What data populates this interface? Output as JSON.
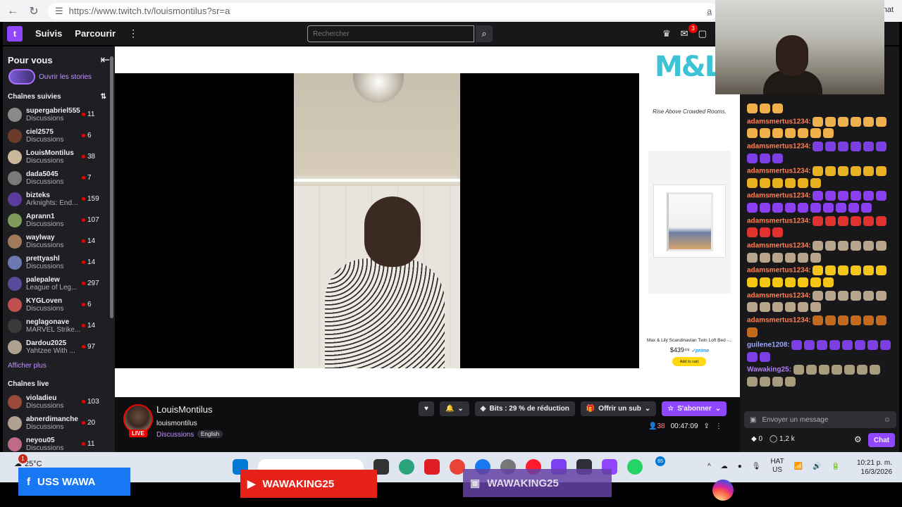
{
  "browser": {
    "url": "https://www.twitch.tv/louismontilus?sr=a",
    "right_text": "hat"
  },
  "topnav": {
    "following": "Suivis",
    "browse": "Parcourir",
    "search_placeholder": "Rechercher",
    "notifications_count": "3"
  },
  "sidebar": {
    "for_you": "Pour vous",
    "stories": "Ouvrir les stories",
    "followed_title": "Chaînes suivies",
    "followed": [
      {
        "name": "supergabriel555",
        "category": "Discussions",
        "viewers": "11"
      },
      {
        "name": "ciel2575",
        "category": "Discussions",
        "viewers": "6"
      },
      {
        "name": "LouisMontilus",
        "category": "Discussions",
        "viewers": "38"
      },
      {
        "name": "dada5045",
        "category": "Discussions",
        "viewers": "7"
      },
      {
        "name": "bizteks",
        "category": "Arknights: End...",
        "viewers": "159"
      },
      {
        "name": "Aprann1",
        "category": "Discussions",
        "viewers": "107"
      },
      {
        "name": "waylway",
        "category": "Discussions",
        "viewers": "14"
      },
      {
        "name": "prettyashl",
        "category": "Discussions",
        "viewers": "14"
      },
      {
        "name": "palepalew",
        "category": "League of Leg...",
        "viewers": "297"
      },
      {
        "name": "KYGLoven",
        "category": "Discussions",
        "viewers": "6"
      },
      {
        "name": "neglagonave",
        "category": "MARVEL Strike...",
        "viewers": "14"
      },
      {
        "name": "Dardou2025",
        "category": "Yahtzee With ...",
        "viewers": "97"
      }
    ],
    "show_more": "Afficher plus",
    "live_title": "Chaînes live",
    "live": [
      {
        "name": "violadieu",
        "category": "Discussions",
        "viewers": "103"
      },
      {
        "name": "abnerdimanche",
        "category": "Discussions",
        "viewers": "20"
      },
      {
        "name": "neyou05",
        "category": "Discussions",
        "viewers": "11"
      }
    ]
  },
  "ad": {
    "logo": "M&L",
    "tagline": "Rise Above Crowded Rooms.",
    "product": "Max & Lily Scandinavian Twin Loft Bed -...",
    "price": "$439⁴⁹",
    "prime": "✓prime",
    "cart": "Add to cart"
  },
  "stream": {
    "name": "LouisMontilus",
    "handle": "louismontilus",
    "category": "Discussions",
    "language": "English",
    "live": "LIVE",
    "bits": "Bits : 29 % de réduction",
    "gift": "Offrir un sub",
    "subscribe": "S'abonner",
    "viewers": "38",
    "uptime": "00:47:09"
  },
  "chat": {
    "messages": [
      {
        "user": "",
        "color": "#ff7f50",
        "emotes": 3,
        "emote_color": "#f0b04c"
      },
      {
        "user": "adamsmertus1234:",
        "color": "#ff7f50",
        "emotes": 13,
        "emote_color": "#f0b04c"
      },
      {
        "user": "adamsmertus1234:",
        "color": "#ff7f50",
        "emotes": 9,
        "emote_color": "#7b3fe4"
      },
      {
        "user": "adamsmertus1234:",
        "color": "#ff7f50",
        "emotes": 12,
        "emote_color": "#e9b022"
      },
      {
        "user": "adamsmertus1234:",
        "color": "#ff7f50",
        "emotes": 16,
        "emote_color": "#8a3ff0"
      },
      {
        "user": "adamsmertus1234:",
        "color": "#ff7f50",
        "emotes": 9,
        "emote_color": "#e0322e"
      },
      {
        "user": "adamsmertus1234:",
        "color": "#ff7f50",
        "emotes": 12,
        "emote_color": "#b7a48a"
      },
      {
        "user": "adamsmertus1234:",
        "color": "#ff7f50",
        "emotes": 13,
        "emote_color": "#f5c518"
      },
      {
        "user": "adamsmertus1234:",
        "color": "#ff7f50",
        "emotes": 12,
        "emote_color": "#b7a48a"
      },
      {
        "user": "adamsmertus1234:",
        "color": "#ff7f50",
        "emotes": 7,
        "emote_color": "#c46a1e"
      },
      {
        "user": "guilene1208:",
        "color": "#9aa6ff",
        "emotes": 10,
        "emote_color": "#7b3fe4"
      },
      {
        "user": "Wawaking25:",
        "color": "#b57cff",
        "emotes": 11,
        "emote_color": "#a89c7e"
      }
    ],
    "input_placeholder": "Envoyer un message",
    "points": "0",
    "bits": "1,2 k",
    "send": "Chat"
  },
  "taskbar": {
    "weather_badge": "1",
    "temperature": "25°C",
    "lang1": "HAT",
    "lang2": "US",
    "time": "10:21 p. m.",
    "date": "16/3/2026",
    "whatsapp_badge": "65"
  },
  "overlays": {
    "facebook": "USS WAWA",
    "youtube": "WAWAKING25",
    "twitch": "WAWAKING25"
  },
  "colors": {
    "twitch_purple": "#9147ff",
    "live_red": "#eb0400"
  }
}
